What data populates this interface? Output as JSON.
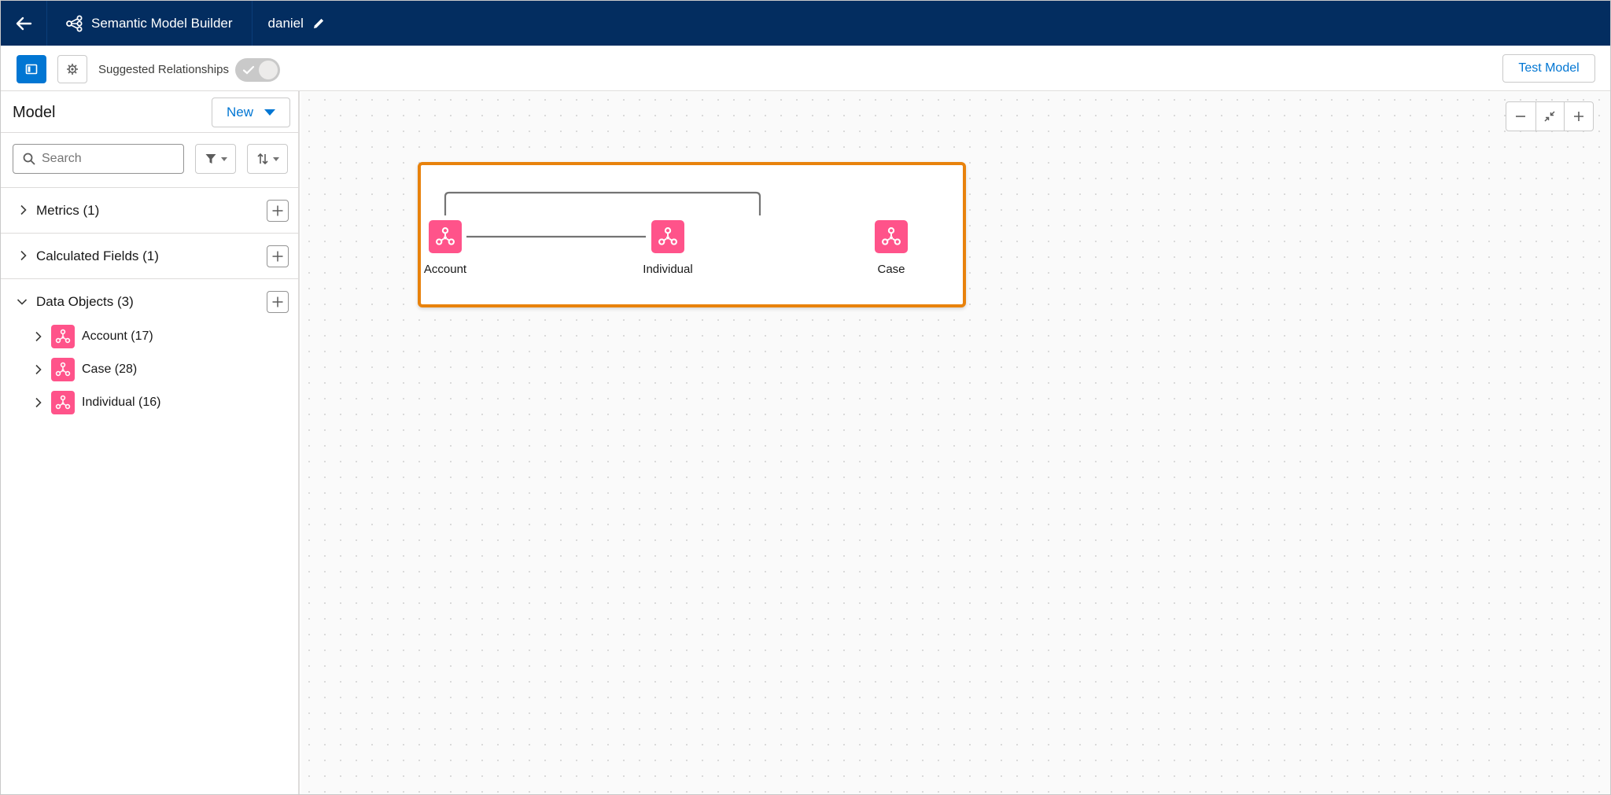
{
  "app": {
    "title": "Semantic Model Builder",
    "model_name": "daniel",
    "icons": {
      "back": "back-arrow-icon",
      "app": "semantic-model-icon",
      "edit": "pencil-icon"
    }
  },
  "toolbar": {
    "suggested_relationships_label": "Suggested Relationships",
    "suggested_relationships_enabled": false,
    "test_model_label": "Test Model"
  },
  "sidebar": {
    "title": "Model",
    "new_label": "New",
    "search_placeholder": "Search",
    "sections": [
      {
        "label": "Metrics (1)",
        "expanded": false
      },
      {
        "label": "Calculated Fields (1)",
        "expanded": false
      },
      {
        "label": "Data Objects (3)",
        "expanded": true
      }
    ],
    "data_objects": [
      {
        "label": "Account (17)"
      },
      {
        "label": "Case (28)"
      },
      {
        "label": "Individual (16)"
      }
    ]
  },
  "canvas": {
    "nodes": [
      {
        "label": "Account"
      },
      {
        "label": "Individual"
      },
      {
        "label": "Case"
      }
    ]
  },
  "colors": {
    "nav": "#032d60",
    "brand": "#0176d3",
    "object_icon": "#ff538a",
    "selection_border": "#e8820c"
  }
}
